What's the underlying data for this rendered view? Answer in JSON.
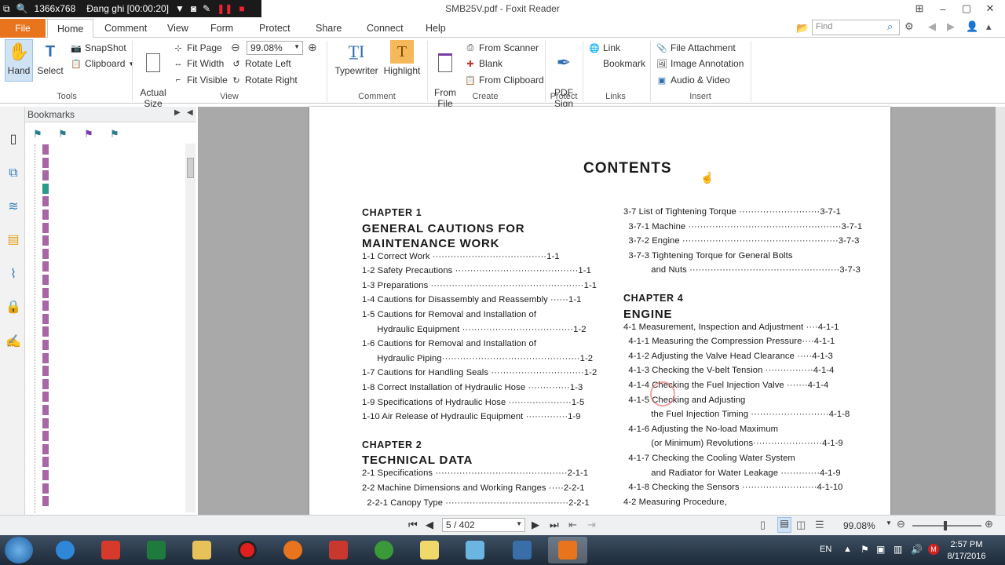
{
  "recorder": {
    "resolution": "1366x768",
    "status": "Đang ghi [00:00:20]"
  },
  "window": {
    "title": "SMB25V.pdf - Foxit Reader"
  },
  "ribbon_tabs": [
    "File",
    "Home",
    "Comment",
    "View",
    "Form",
    "Protect",
    "Share",
    "Connect",
    "Help"
  ],
  "find": {
    "placeholder": "Find"
  },
  "ribbon": {
    "tools": {
      "label": "Tools",
      "hand": "Hand",
      "select": "Select",
      "snapshot": "SnapShot",
      "clipboard": "Clipboard"
    },
    "view": {
      "label": "View",
      "actual_size": "Actual\nSize",
      "fit_page": "Fit Page",
      "fit_width": "Fit Width",
      "fit_visible": "Fit Visible",
      "zoom": "99.08%",
      "rotate_left": "Rotate Left",
      "rotate_right": "Rotate Right"
    },
    "comment": {
      "label": "Comment",
      "typewriter": "Typewriter",
      "highlight": "Highlight"
    },
    "create": {
      "label": "Create",
      "from_file": "From\nFile",
      "from_scanner": "From Scanner",
      "blank": "Blank",
      "from_clipboard": "From Clipboard"
    },
    "protect": {
      "label": "Protect",
      "pdf_sign": "PDF\nSign"
    },
    "links": {
      "label": "Links",
      "link": "Link",
      "bookmark": "Bookmark"
    },
    "insert": {
      "label": "Insert",
      "file_attachment": "File Attachment",
      "image_annotation": "Image Annotation",
      "audio_video": "Audio & Video"
    }
  },
  "bookmarks": {
    "title": "Bookmarks"
  },
  "document": {
    "heading": "CONTENTS",
    "left": [
      {
        "t": "CHAPTER 1",
        "kind": "chap"
      },
      {
        "t": "GENERAL CAUTIONS FOR",
        "kind": "title"
      },
      {
        "t": "MAINTENANCE WORK",
        "kind": "title"
      },
      {
        "t": "1-1 Correct Work ······································1-1"
      },
      {
        "t": "1-2 Safety Precautions ·········································1-1"
      },
      {
        "t": "1-3 Preparations ···················································1-1"
      },
      {
        "t": "1-4 Cautions for Disassembly and Reassembly ······1-1"
      },
      {
        "t": "1-5 Cautions for Removal and Installation of"
      },
      {
        "t": "      Hydraulic Equipment ·····································1-2"
      },
      {
        "t": "1-6 Cautions for Removal and Installation of"
      },
      {
        "t": "      Hydraulic Piping··············································1-2"
      },
      {
        "t": "1-7 Cautions for Handling Seals ·······························1-2"
      },
      {
        "t": "1-8 Correct Installation of Hydraulic Hose ··············1-3"
      },
      {
        "t": "1-9 Specifications of Hydraulic Hose ·····················1-5"
      },
      {
        "t": "1-10 Air Release of Hydraulic Equipment ··············1-9"
      },
      {
        "t": "CHAPTER 2",
        "kind": "chap"
      },
      {
        "t": "TECHNICAL DATA",
        "kind": "title"
      },
      {
        "t": "2-1 Specifications ············································2-1-1"
      },
      {
        "t": "2-2 Machine Dimensions and Working Ranges ·····2-2-1"
      },
      {
        "t": "  2-2-1 Canopy Type ·········································2-2-1"
      }
    ],
    "right": [
      {
        "t": "3-7 List of Tightening Torque ···························3-7-1"
      },
      {
        "t": "  3-7-1 Machine ···················································3-7-1"
      },
      {
        "t": "  3-7-2 Engine ····················································3-7-3"
      },
      {
        "t": "  3-7-3 Tightening Torque for General Bolts"
      },
      {
        "t": "           and Nuts ··················································3-7-3"
      },
      {
        "t": "CHAPTER 4",
        "kind": "chap"
      },
      {
        "t": "ENGINE",
        "kind": "title"
      },
      {
        "t": "4-1 Measurement, Inspection and Adjustment ····4-1-1"
      },
      {
        "t": "  4-1-1 Measuring the Compression Pressure····4-1-1"
      },
      {
        "t": "  4-1-2 Adjusting the Valve Head Clearance ·····4-1-3"
      },
      {
        "t": "  4-1-3 Checking the V-belt Tension ················4-1-4"
      },
      {
        "t": "  4-1-4 Checking the Fuel Injection Valve ·······4-1-4"
      },
      {
        "t": "  4-1-5 Checking and Adjusting"
      },
      {
        "t": "           the Fuel Injection Timing ··························4-1-8"
      },
      {
        "t": "  4-1-6 Adjusting the No-load Maximum"
      },
      {
        "t": "           (or Minimum) Revolutions·······················4-1-9"
      },
      {
        "t": "  4-1-7 Checking the Cooling Water System"
      },
      {
        "t": "           and Radiator for Water Leakage ·············4-1-9"
      },
      {
        "t": "  4-1-8 Checking the Sensors ·························4-1-10"
      },
      {
        "t": "4-2 Measuring Procedure,"
      }
    ]
  },
  "status": {
    "page": "5 / 402",
    "zoom": "99.08%"
  },
  "tray": {
    "lang": "EN",
    "time": "2:57 PM",
    "date": "8/17/2016"
  },
  "colors": {
    "file_tab": "#e8741d",
    "doc_bg": "#a9a9a9",
    "bookmark_flag": "#a866a8"
  }
}
